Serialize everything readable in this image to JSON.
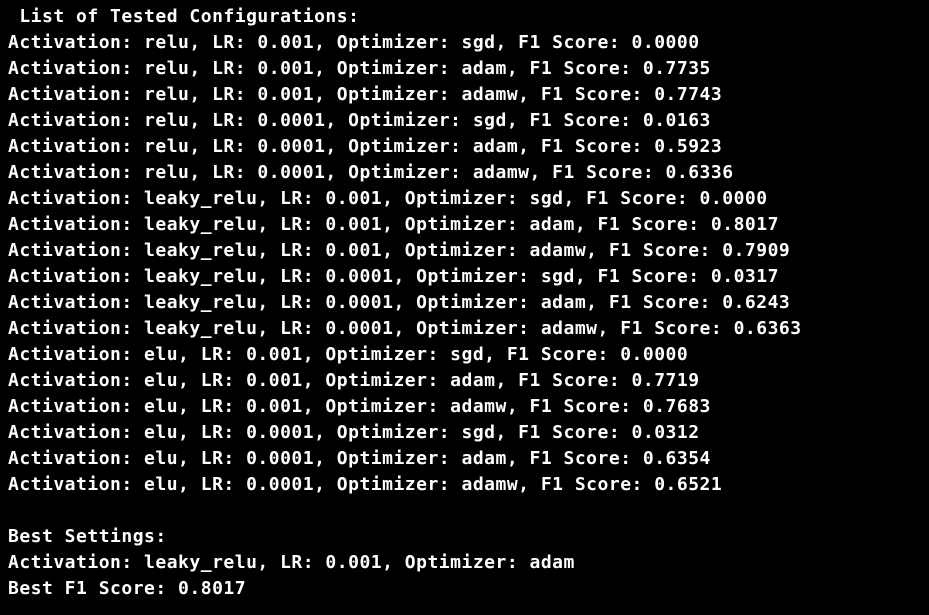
{
  "header": " List of Tested Configurations:",
  "configs": [
    "Activation: relu, LR: 0.001, Optimizer: sgd, F1 Score: 0.0000",
    "Activation: relu, LR: 0.001, Optimizer: adam, F1 Score: 0.7735",
    "Activation: relu, LR: 0.001, Optimizer: adamw, F1 Score: 0.7743",
    "Activation: relu, LR: 0.0001, Optimizer: sgd, F1 Score: 0.0163",
    "Activation: relu, LR: 0.0001, Optimizer: adam, F1 Score: 0.5923",
    "Activation: relu, LR: 0.0001, Optimizer: adamw, F1 Score: 0.6336",
    "Activation: leaky_relu, LR: 0.001, Optimizer: sgd, F1 Score: 0.0000",
    "Activation: leaky_relu, LR: 0.001, Optimizer: adam, F1 Score: 0.8017",
    "Activation: leaky_relu, LR: 0.001, Optimizer: adamw, F1 Score: 0.7909",
    "Activation: leaky_relu, LR: 0.0001, Optimizer: sgd, F1 Score: 0.0317",
    "Activation: leaky_relu, LR: 0.0001, Optimizer: adam, F1 Score: 0.6243",
    "Activation: leaky_relu, LR: 0.0001, Optimizer: adamw, F1 Score: 0.6363",
    "Activation: elu, LR: 0.001, Optimizer: sgd, F1 Score: 0.0000",
    "Activation: elu, LR: 0.001, Optimizer: adam, F1 Score: 0.7719",
    "Activation: elu, LR: 0.001, Optimizer: adamw, F1 Score: 0.7683",
    "Activation: elu, LR: 0.0001, Optimizer: sgd, F1 Score: 0.0312",
    "Activation: elu, LR: 0.0001, Optimizer: adam, F1 Score: 0.6354",
    "Activation: elu, LR: 0.0001, Optimizer: adamw, F1 Score: 0.6521"
  ],
  "best": {
    "heading": "Best Settings:",
    "settings": "Activation: leaky_relu, LR: 0.001, Optimizer: adam",
    "score": "Best F1 Score: 0.8017"
  }
}
